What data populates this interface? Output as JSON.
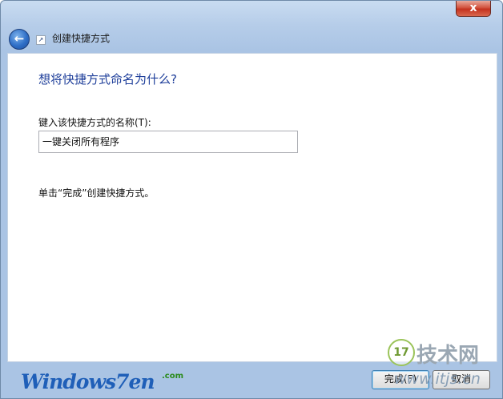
{
  "window": {
    "close_glyph": "x",
    "title": "创建快捷方式"
  },
  "page": {
    "heading": "想将快捷方式命名为什么?",
    "name_label": "键入该快捷方式的名称(T):",
    "name_value": "一键关闭所有程序",
    "hint": "单击“完成”创建快捷方式。"
  },
  "buttons": {
    "finish_label": "完成(F)",
    "cancel_label": "取消"
  },
  "watermark": {
    "logo_text": "Windows7en",
    "logo_com": ".com",
    "circle_text": "17",
    "site_cn": "技术网",
    "site_url": "www.itjs.cn"
  },
  "icons": {
    "back": "back-arrow-icon",
    "shortcut": "shortcut-icon",
    "close": "close-icon"
  }
}
